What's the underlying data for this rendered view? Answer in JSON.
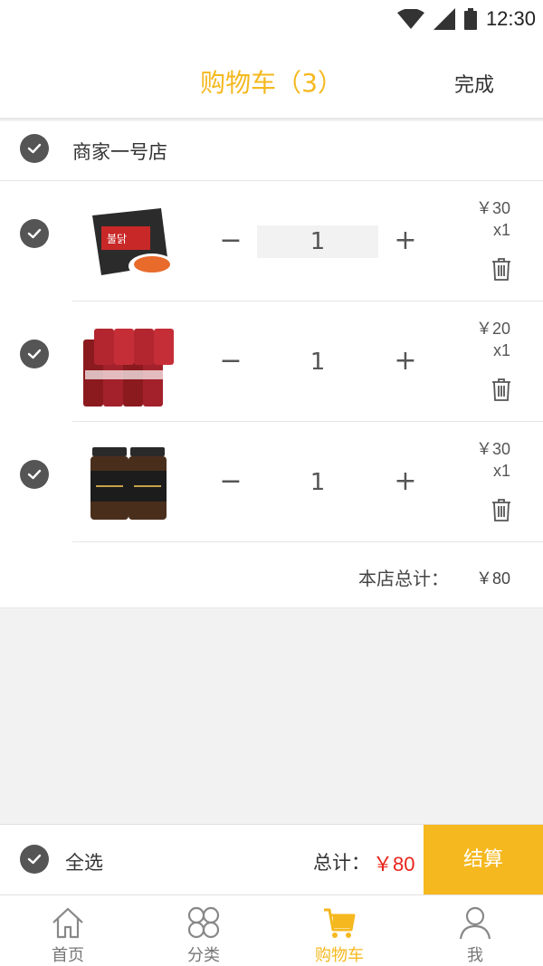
{
  "status": {
    "time": "12:30"
  },
  "header": {
    "title": "购物车（3）",
    "done": "完成"
  },
  "shop": {
    "name": "商家一号店",
    "items": [
      {
        "qty": "1",
        "price": "￥30",
        "count": "x1",
        "image": "spicy-noodles-pack"
      },
      {
        "qty": "1",
        "price": "￥20",
        "count": "x1",
        "image": "dr-pepper-cans"
      },
      {
        "qty": "1",
        "price": "￥30",
        "count": "x1",
        "image": "coffee-jars-117"
      }
    ],
    "total_label": "本店总计：",
    "total_value": "￥80"
  },
  "checkout": {
    "select_all": "全选",
    "total_label": "总计：",
    "total_value": "￥80",
    "pay": "结算"
  },
  "tabs": [
    {
      "label": "首页",
      "icon": "home-icon"
    },
    {
      "label": "分类",
      "icon": "category-icon"
    },
    {
      "label": "购物车",
      "icon": "cart-icon",
      "active": true
    },
    {
      "label": "我",
      "icon": "user-icon"
    }
  ],
  "colors": {
    "accent": "#f5b81f",
    "price_red": "#e8231b",
    "check_dark": "#555555"
  }
}
